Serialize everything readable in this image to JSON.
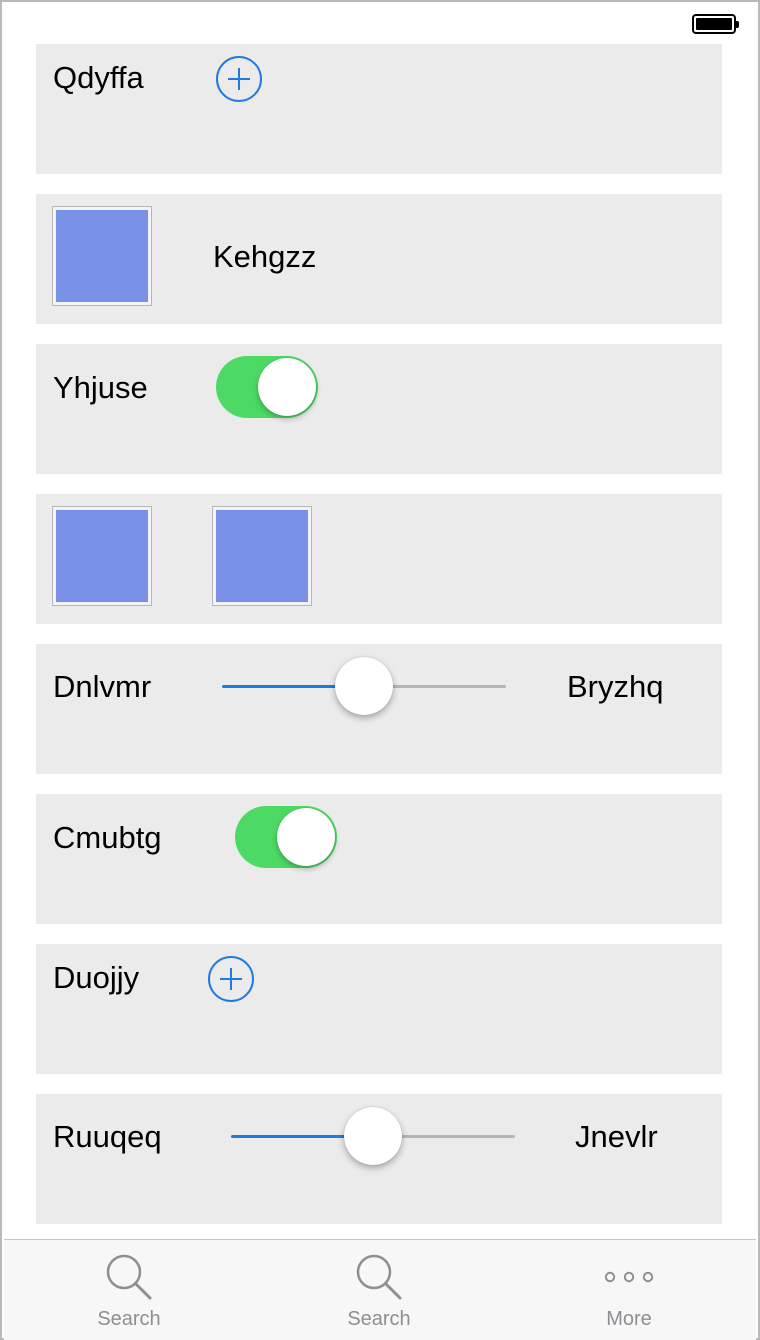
{
  "status_bar": {
    "battery": "full"
  },
  "rows": [
    {
      "type": "add",
      "label": "Qdyffa",
      "icon": "plus-circle-icon"
    },
    {
      "type": "image-label",
      "label": "Kehgzz",
      "image_color": "#7891e6"
    },
    {
      "type": "toggle",
      "label": "Yhjuse",
      "on": true
    },
    {
      "type": "images",
      "image_color": "#7891e6"
    },
    {
      "type": "slider",
      "min_label": "Dnlvmr",
      "max_label": "Bryzhq",
      "value_fraction": 0.5
    },
    {
      "type": "toggle",
      "label": "Cmubtg",
      "on": true
    },
    {
      "type": "add",
      "label": "Duojjy",
      "icon": "plus-circle-icon"
    },
    {
      "type": "slider",
      "min_label": "Ruuqeq",
      "max_label": "Jnevlr",
      "value_fraction": 0.5
    }
  ],
  "tabbar": {
    "tabs": [
      {
        "label": "Search",
        "icon": "search-icon"
      },
      {
        "label": "Search",
        "icon": "search-icon"
      },
      {
        "label": "More",
        "icon": "more-icon"
      }
    ]
  },
  "colors": {
    "accent": "#1f7ae3",
    "toggle_on": "#4cd964",
    "row_bg": "#ebebeb",
    "tab_inactive": "#8e8e93"
  }
}
